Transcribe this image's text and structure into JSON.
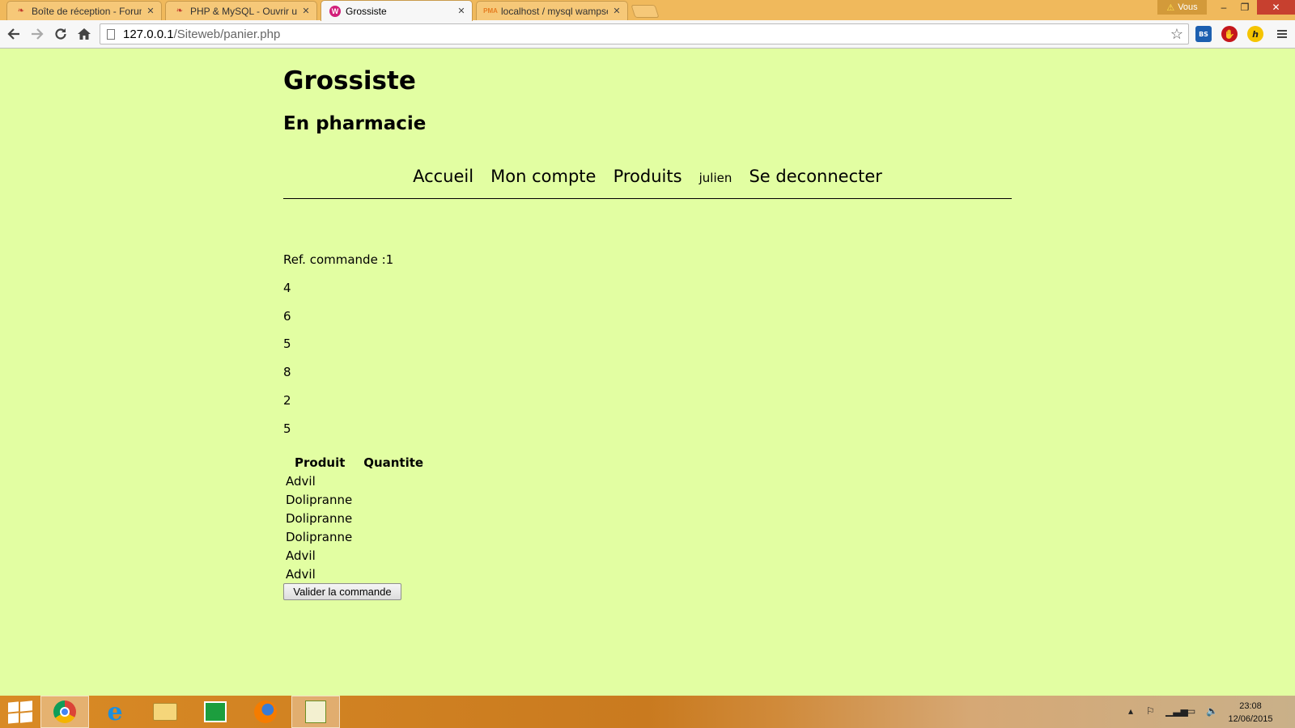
{
  "browser": {
    "tabs": [
      {
        "title": "Boîte de réception - Forum",
        "active": false
      },
      {
        "title": "PHP & MySQL - Ouvrir un",
        "active": false
      },
      {
        "title": "Grossiste",
        "active": true
      },
      {
        "title": "localhost / mysql wampse",
        "active": false
      }
    ],
    "profile_label": "Vous",
    "url_host": "127.0.0.1",
    "url_path": "/Siteweb/panier.php"
  },
  "page": {
    "title": "Grossiste",
    "subtitle": "En pharmacie",
    "nav": {
      "accueil": "Accueil",
      "mon_compte": "Mon compte",
      "produits": "Produits",
      "user": "julien",
      "deconnecter": "Se deconnecter"
    },
    "ref_commande": "Ref. commande :1",
    "numbers": [
      "4",
      "6",
      "5",
      "8",
      "2",
      "5"
    ],
    "table": {
      "headers": [
        "Produit",
        "Quantite"
      ],
      "rows": [
        {
          "produit": "Advil",
          "quantite": ""
        },
        {
          "produit": "Dolipranne",
          "quantite": ""
        },
        {
          "produit": "Dolipranne",
          "quantite": ""
        },
        {
          "produit": "Dolipranne",
          "quantite": ""
        },
        {
          "produit": "Advil",
          "quantite": ""
        },
        {
          "produit": "Advil",
          "quantite": ""
        }
      ]
    },
    "submit_label": "Valider la commande"
  },
  "taskbar": {
    "time": "23:08",
    "date": "12/06/2015"
  },
  "colors": {
    "page_bg": "#e2fea2",
    "tabstrip": "#f0b95c",
    "taskbar": "#d98a25"
  }
}
